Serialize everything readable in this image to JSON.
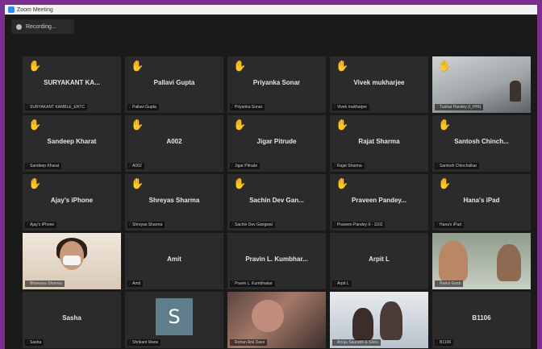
{
  "window": {
    "title": "Zoom Meeting"
  },
  "recording": {
    "label": "Recording..."
  },
  "participants": [
    {
      "name": "SURYAKANT KA...",
      "caption": "SURYAKANT KAMBLE_ENTC",
      "hand": true,
      "video": null
    },
    {
      "name": "Pallavi Gupta",
      "caption": "Pallavi Gupta",
      "hand": true,
      "video": null
    },
    {
      "name": "Priyanka Sonar",
      "caption": "Priyanka Sonar",
      "hand": true,
      "video": null
    },
    {
      "name": "Vivek mukharjee",
      "caption": "Vivek mukharjee",
      "hand": true,
      "video": null
    },
    {
      "name": "",
      "caption": "Tushar Pandey (I_HHI)",
      "hand": true,
      "video": "room"
    },
    {
      "name": "Sandeep Kharat",
      "caption": "Sandeep Kharat",
      "hand": true,
      "video": null
    },
    {
      "name": "A002",
      "caption": "A002",
      "hand": true,
      "video": null
    },
    {
      "name": "Jigar Pitrude",
      "caption": "Jigar Pitrude",
      "hand": true,
      "video": null
    },
    {
      "name": "Rajat Sharma",
      "caption": "Rajat Sharma",
      "hand": true,
      "video": null
    },
    {
      "name": "Santosh Chinch...",
      "caption": "Santosh Chinchalkar",
      "hand": true,
      "video": null
    },
    {
      "name": "Ajay's iPhone",
      "caption": "Ajay's iPhone",
      "hand": true,
      "video": null
    },
    {
      "name": "Shreyas Sharma",
      "caption": "Shreyas Sharma",
      "hand": true,
      "video": null
    },
    {
      "name": "Sachin Dev Gan...",
      "caption": "Sachin Dev Gangwal",
      "hand": true,
      "video": null
    },
    {
      "name": "Praveen Pandey...",
      "caption": "Praveen Pandey II - 1102",
      "hand": true,
      "video": null
    },
    {
      "name": "Hana's iPad",
      "caption": "Hana's iPad",
      "hand": true,
      "video": null
    },
    {
      "name": "",
      "caption": "Bhawana Sharma",
      "hand": false,
      "video": "face"
    },
    {
      "name": "Amit",
      "caption": "Amit",
      "hand": false,
      "video": null
    },
    {
      "name": "Pravin L. Kumbhar...",
      "caption": "Pravin L. Kumbhakar",
      "hand": false,
      "video": null
    },
    {
      "name": "Arpit L",
      "caption": "Arpit L",
      "hand": false,
      "video": null
    },
    {
      "name": "",
      "caption": "Rahul Gosh",
      "hand": false,
      "video": "duo",
      "active": true
    },
    {
      "name": "Sasha",
      "caption": "Sasha",
      "hand": false,
      "video": null
    },
    {
      "name": "",
      "caption": "Shrikant Mane",
      "hand": false,
      "video": "avatar",
      "avatar_letter": "S"
    },
    {
      "name": "",
      "caption": "Rohan Anil Dave",
      "hand": false,
      "video": "dark"
    },
    {
      "name": "",
      "caption": "Anuja Saurabh & Sonu",
      "hand": false,
      "video": "kids"
    },
    {
      "name": "B1106",
      "caption": "B1106",
      "hand": false,
      "video": null
    }
  ],
  "icons": {
    "hand": "raised-hand-icon",
    "mic": "muted-mic-icon",
    "recording": "recording-icon"
  },
  "colors": {
    "frame": "#7b2f8e",
    "tile": "#2b2b2b",
    "hand": "#f5c518",
    "muted": "#e02f2f",
    "active_speaker": "#f3e65a"
  }
}
